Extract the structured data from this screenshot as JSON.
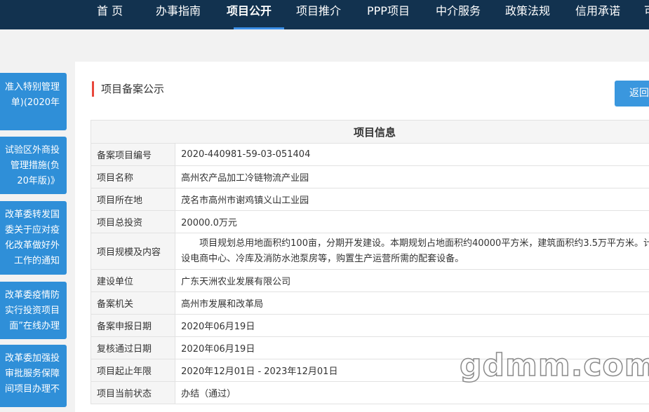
{
  "nav": {
    "items": [
      "首 页",
      "办事指南",
      "项目公开",
      "项目推介",
      "PPP项目",
      "中介服务",
      "政策法规",
      "信用承诺",
      "可"
    ],
    "active_index": 2
  },
  "sidebar": {
    "cards": [
      {
        "lines": [
          "准入特别管理",
          "单)(2020年"
        ]
      },
      {
        "lines": [
          "试验区外商投",
          "管理措施(负",
          "20年版)》"
        ]
      },
      {
        "lines": [
          "改革委转发国",
          "委关于应对疫",
          "化改革做好外",
          "工作的通知"
        ]
      },
      {
        "lines": [
          "改革委疫情防",
          "实行投资项目",
          "面”在线办理"
        ]
      },
      {
        "lines": [
          "改革委加强投",
          "审批服务保障",
          "间项目办理不"
        ]
      }
    ]
  },
  "page": {
    "section_title": "项目备案公示",
    "back_button": "返回"
  },
  "table": {
    "header": "项目信息",
    "rows": [
      {
        "label": "备案项目编号",
        "value": "2020-440981-59-03-051404"
      },
      {
        "label": "项目名称",
        "value": "高州农产品加工冷链物流产业园"
      },
      {
        "label": "项目所在地",
        "value": "茂名市高州市谢鸡镇义山工业园"
      },
      {
        "label": "项目总投资",
        "value": "20000.0万元"
      },
      {
        "label": "项目规模及内容",
        "value_line1": "　　项目规划总用地面积约100亩，分期开发建设。本期规划占地面积约40000平方米，建筑面积约3.5万平方米。计",
        "value_line2": "设电商中心、冷库及消防水池泵房等，购置生产运营所需的配套设备。"
      },
      {
        "label": "建设单位",
        "value": "广东天洲农业发展有限公司"
      },
      {
        "label": "备案机关",
        "value": "高州市发展和改革局"
      },
      {
        "label": "备案申报日期",
        "value": "2020年06月19日"
      },
      {
        "label": "复核通过日期",
        "value": "2020年06月19日"
      },
      {
        "label": "项目起止年限",
        "value": "2020年12月01日 - 2023年12月01日"
      },
      {
        "label": "项目当前状态",
        "value": "办结（通过）"
      }
    ]
  },
  "watermark": "gdmm.com"
}
